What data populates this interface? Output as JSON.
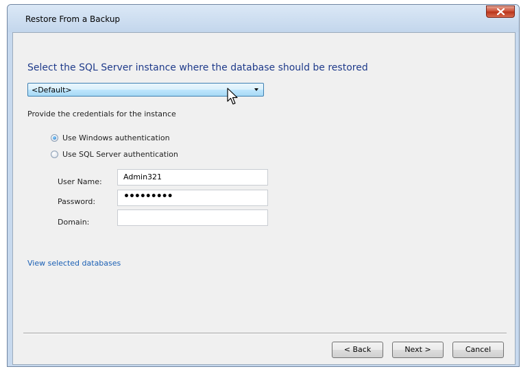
{
  "window": {
    "title": "Restore From a Backup"
  },
  "instance": {
    "heading": "Select the SQL Server instance where the database should be restored",
    "selected_value": "<Default>"
  },
  "credentials": {
    "label": "Provide the credentials for the instance",
    "auth_options": [
      {
        "label": "Use Windows authentication",
        "selected": true
      },
      {
        "label": "Use SQL Server authentication",
        "selected": false
      }
    ],
    "fields": {
      "username_label": "User Name:",
      "username_value": "Admin321",
      "password_label": "Password:",
      "password_value": "•••••••••",
      "domain_label": "Domain:",
      "domain_value": ""
    }
  },
  "links": {
    "view_databases": "View selected databases"
  },
  "buttons": {
    "back": "< Back",
    "next": "Next >",
    "cancel": "Cancel"
  },
  "colors": {
    "accent": "#1e3a8a",
    "link": "#1a5fb4",
    "close_button": "#c9482f"
  },
  "icons": {
    "close": "close-icon",
    "dropdown": "chevron-down-icon",
    "cursor": "mouse-pointer-icon"
  }
}
